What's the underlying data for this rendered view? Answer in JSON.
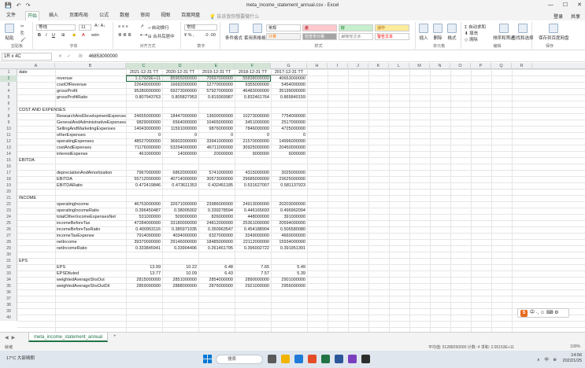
{
  "window": {
    "title": "meta_income_statement_annual.csv - Excel",
    "user": "登录",
    "share": "共享"
  },
  "ribbon_tabs": [
    "文件",
    "开始",
    "插入",
    "页面布局",
    "公式",
    "数据",
    "审阅",
    "视图",
    "百度网盘"
  ],
  "ribbon_search": "告诉我你想要做什么",
  "ribbon": {
    "paste": "粘贴",
    "clipboard": "剪贴板",
    "font_name": "等线",
    "font_size": "11",
    "font_group": "字体",
    "align_group": "对齐方式",
    "wrap": "自动换行",
    "merge": "合并后居中",
    "number_format": "常规",
    "number_group": "数字",
    "cond_format": "条件格式",
    "table_format": "套用表格格式",
    "styles": [
      {
        "label": "常规",
        "bg": "#ffffff"
      },
      {
        "label": "差",
        "bg": "#ffc7ce"
      },
      {
        "label": "好",
        "bg": "#c6efce"
      },
      {
        "label": "适中",
        "bg": "#ffeb9c"
      },
      {
        "label": "计算",
        "bg": "#f2f2f2"
      },
      {
        "label": "检查单元格",
        "bg": "#a5a5a5"
      },
      {
        "label": "解释性文本",
        "bg": "#ffffff"
      },
      {
        "label": "警告文本",
        "bg": "#ffffff"
      }
    ],
    "styles_group": "样式",
    "insert": "插入",
    "delete": "删除",
    "format": "格式",
    "cells_group": "单元格",
    "autosum": "自动求和",
    "fill": "填充",
    "clear": "清除",
    "sort": "排序和筛选",
    "find": "查找和选择",
    "edit_group": "编辑",
    "save_baidu": "保存到百度网盘",
    "save_group": "保存"
  },
  "formula_bar": {
    "name_box": "1R x 4C",
    "fx": "fx",
    "value": "46853000000"
  },
  "columns": [
    "A",
    "B",
    "C",
    "D",
    "E",
    "F",
    "G",
    "H",
    "I",
    "J",
    "K",
    "L",
    "M",
    "N",
    "O",
    "P",
    "Q",
    "R"
  ],
  "rows": [
    {
      "n": "1",
      "a": "date",
      "b": "",
      "c": "2021-12-31 TT",
      "d": "2020-12-31 TT",
      "e": "2019-12-31 TT",
      "f": "2018-12-31 TT",
      "g": "2017-12-31 TT"
    },
    {
      "n": "2",
      "a": "",
      "b": "revenue",
      "c": "1.17929E+11",
      "d": "85965000000",
      "e": "70697000000",
      "f": "55838000000",
      "g": "40653000000"
    },
    {
      "n": "3",
      "a": "",
      "b": "costOfRevenue",
      "c": "22649000000",
      "d": "16692000000",
      "e": "12770000000",
      "f": "9355000000",
      "g": "5454000000"
    },
    {
      "n": "4",
      "a": "",
      "b": "grossProfit",
      "c": "95280000000",
      "d": "69273000000",
      "e": "57927000000",
      "f": "46483000000",
      "g": "35199000000"
    },
    {
      "n": "5",
      "a": "",
      "b": "grossProfitRatio",
      "c": "0.807943763",
      "d": "0.805827953",
      "e": "0.819369987",
      "f": "0.832461764",
      "g": "0.865840159"
    },
    {
      "n": "6",
      "a": "",
      "b": "",
      "c": "",
      "d": "",
      "e": "",
      "f": "",
      "g": ""
    },
    {
      "n": "7",
      "a": "COST AND EXPENSES",
      "b": "",
      "c": "",
      "d": "",
      "e": "",
      "f": "",
      "g": ""
    },
    {
      "n": "8",
      "a": "",
      "b": "ResearchAndDevelopmentExpenses",
      "c": "24655000000",
      "d": "18447000000",
      "e": "13600000000",
      "f": "10273000000",
      "g": "7754000000"
    },
    {
      "n": "9",
      "a": "",
      "b": "GeneralAndAdministrativeExpenses",
      "c": "9829000000",
      "d": "6564000000",
      "e": "10465000000",
      "f": "3451000000",
      "g": "2517000000"
    },
    {
      "n": "10",
      "a": "",
      "b": "SellingAndMarketingExpenses",
      "c": "14043000000",
      "d": "11591000000",
      "e": "9876000000",
      "f": "7846000000",
      "g": "4725000000"
    },
    {
      "n": "11",
      "a": "",
      "b": "otherExpenses",
      "c": "0",
      "d": "0",
      "e": "0",
      "f": "0",
      "g": "0"
    },
    {
      "n": "12",
      "a": "",
      "b": "operatingExpenses",
      "c": "48527000000",
      "d": "36602000000",
      "e": "33941000000",
      "f": "21570000000",
      "g": "14996000000"
    },
    {
      "n": "13",
      "a": "",
      "b": "costAndExpenses",
      "c": "71176000000",
      "d": "53294000000",
      "e": "46711000000",
      "f": "30925000000",
      "g": "20450000000"
    },
    {
      "n": "14",
      "a": "",
      "b": "interestExpense",
      "c": "461000000",
      "d": "14000000",
      "e": "20000000",
      "f": "9000000",
      "g": "6000000"
    },
    {
      "n": "15",
      "a": "EBITDA",
      "b": "",
      "c": "",
      "d": "",
      "e": "",
      "f": "",
      "g": ""
    },
    {
      "n": "16",
      "a": "",
      "b": "",
      "c": "",
      "d": "",
      "e": "",
      "f": "",
      "g": ""
    },
    {
      "n": "17",
      "a": "",
      "b": "depreciationAndAmortization",
      "c": "7967000000",
      "d": "6862000000",
      "e": "5741000000",
      "f": "4315000000",
      "g": "3025000000"
    },
    {
      "n": "18",
      "a": "",
      "b": "EBITDA",
      "c": "55712000000",
      "d": "40714000000",
      "e": "30573000000",
      "f": "29685000000",
      "g": "23625000000"
    },
    {
      "n": "19",
      "a": "",
      "b": "EBITDARatio",
      "c": "0.472419846",
      "d": "0.473611353",
      "e": "0.432451185",
      "f": "0.531627007",
      "g": "0.581137923"
    },
    {
      "n": "20",
      "a": "",
      "b": "",
      "c": "",
      "d": "",
      "e": "",
      "f": "",
      "g": ""
    },
    {
      "n": "21",
      "a": "INCOME",
      "b": "",
      "c": "",
      "d": "",
      "e": "",
      "f": "",
      "g": ""
    },
    {
      "n": "22",
      "a": "",
      "b": "operatingIncome",
      "c": "46753000000",
      "d": "32671000000",
      "e": "23986000000",
      "f": "24913000000",
      "g": "20203000000"
    },
    {
      "n": "23",
      "a": "",
      "b": "operatingIncomeRatio",
      "c": "0.396450487",
      "d": "0.38005002",
      "e": "0.339278594",
      "f": "0.446165693",
      "g": "0.496962094"
    },
    {
      "n": "24",
      "a": "",
      "b": "totalOtherIncomeExpensesNet",
      "c": "531000000",
      "d": "509000000",
      "e": "826000000",
      "f": "448000000",
      "g": "391000000"
    },
    {
      "n": "25",
      "a": "",
      "b": "incomeBeforeTax",
      "c": "47284000000",
      "d": "33180000000",
      "e": "24812000000",
      "f": "25361000000",
      "g": "20594000000"
    },
    {
      "n": "26",
      "a": "",
      "b": "incomeBeforeTaxRatio",
      "c": "0.400953116",
      "d": "0.385971035",
      "e": "0.350963547",
      "f": "0.454188904",
      "g": "0.506580080"
    },
    {
      "n": "27",
      "a": "",
      "b": "incomeTaxExpense",
      "c": "7914000000",
      "d": "4034000000",
      "e": "6327000000",
      "f": "3249000000",
      "g": "4660000000"
    },
    {
      "n": "28",
      "a": "",
      "b": "netIncome",
      "c": "39370000000",
      "d": "29146000000",
      "e": "18485000000",
      "f": "22112000000",
      "g": "15934000000"
    },
    {
      "n": "29",
      "a": "",
      "b": "netIncomeRatio",
      "c": "0.333845941",
      "d": "0.33904496",
      "e": "0.261461795",
      "f": "0.396002722",
      "g": "0.391951391"
    },
    {
      "n": "30",
      "a": "",
      "b": "",
      "c": "",
      "d": "",
      "e": "",
      "f": "",
      "g": ""
    },
    {
      "n": "31",
      "a": "EPS",
      "b": "",
      "c": "",
      "d": "",
      "e": "",
      "f": "",
      "g": ""
    },
    {
      "n": "32",
      "a": "",
      "b": "EPS",
      "c": "13.99",
      "d": "10.22",
      "e": "6.48",
      "f": "7.65",
      "g": "5.49"
    },
    {
      "n": "33",
      "a": "",
      "b": "EPSDiluted",
      "c": "13.77",
      "d": "10.09",
      "e": "6.43",
      "f": "7.57",
      "g": "5.39"
    },
    {
      "n": "34",
      "a": "",
      "b": "weightedAverageShsOut",
      "c": "2815000000",
      "d": "2851000000",
      "e": "2854000000",
      "f": "2890000000",
      "g": "2901000000"
    },
    {
      "n": "35",
      "a": "",
      "b": "weightedAverageShsOutDil",
      "c": "2859000000",
      "d": "2888000000",
      "e": "2876000000",
      "f": "2921000000",
      "g": "2956000000"
    },
    {
      "n": "36",
      "a": "",
      "b": "",
      "c": "",
      "d": "",
      "e": "",
      "f": "",
      "g": ""
    },
    {
      "n": "37",
      "a": "",
      "b": "",
      "c": "",
      "d": "",
      "e": "",
      "f": "",
      "g": ""
    },
    {
      "n": "38",
      "a": "",
      "b": "",
      "c": "",
      "d": "",
      "e": "",
      "f": "",
      "g": ""
    },
    {
      "n": "39",
      "a": "",
      "b": "",
      "c": "",
      "d": "",
      "e": "",
      "f": "",
      "g": ""
    },
    {
      "n": "40",
      "a": "",
      "b": "",
      "c": "",
      "d": "",
      "e": "",
      "f": "",
      "g": ""
    }
  ],
  "sheet_tab": "meta_income_statement_annual",
  "add_sheet": "+",
  "status": {
    "ready": "就绪",
    "stats": "平均值: 51288250000    计数: 4    求和: 2.05153E+11",
    "zoom": "100%"
  },
  "taskbar": {
    "weather": "17°C 大部晴朗",
    "search": "搜索",
    "tray": "∧ 中 ⊕",
    "time": "14:56",
    "date": "2022/1/25"
  },
  "ime": {
    "logo": "S",
    "label": "中 ·, ☺ ⌨ ⚙"
  }
}
